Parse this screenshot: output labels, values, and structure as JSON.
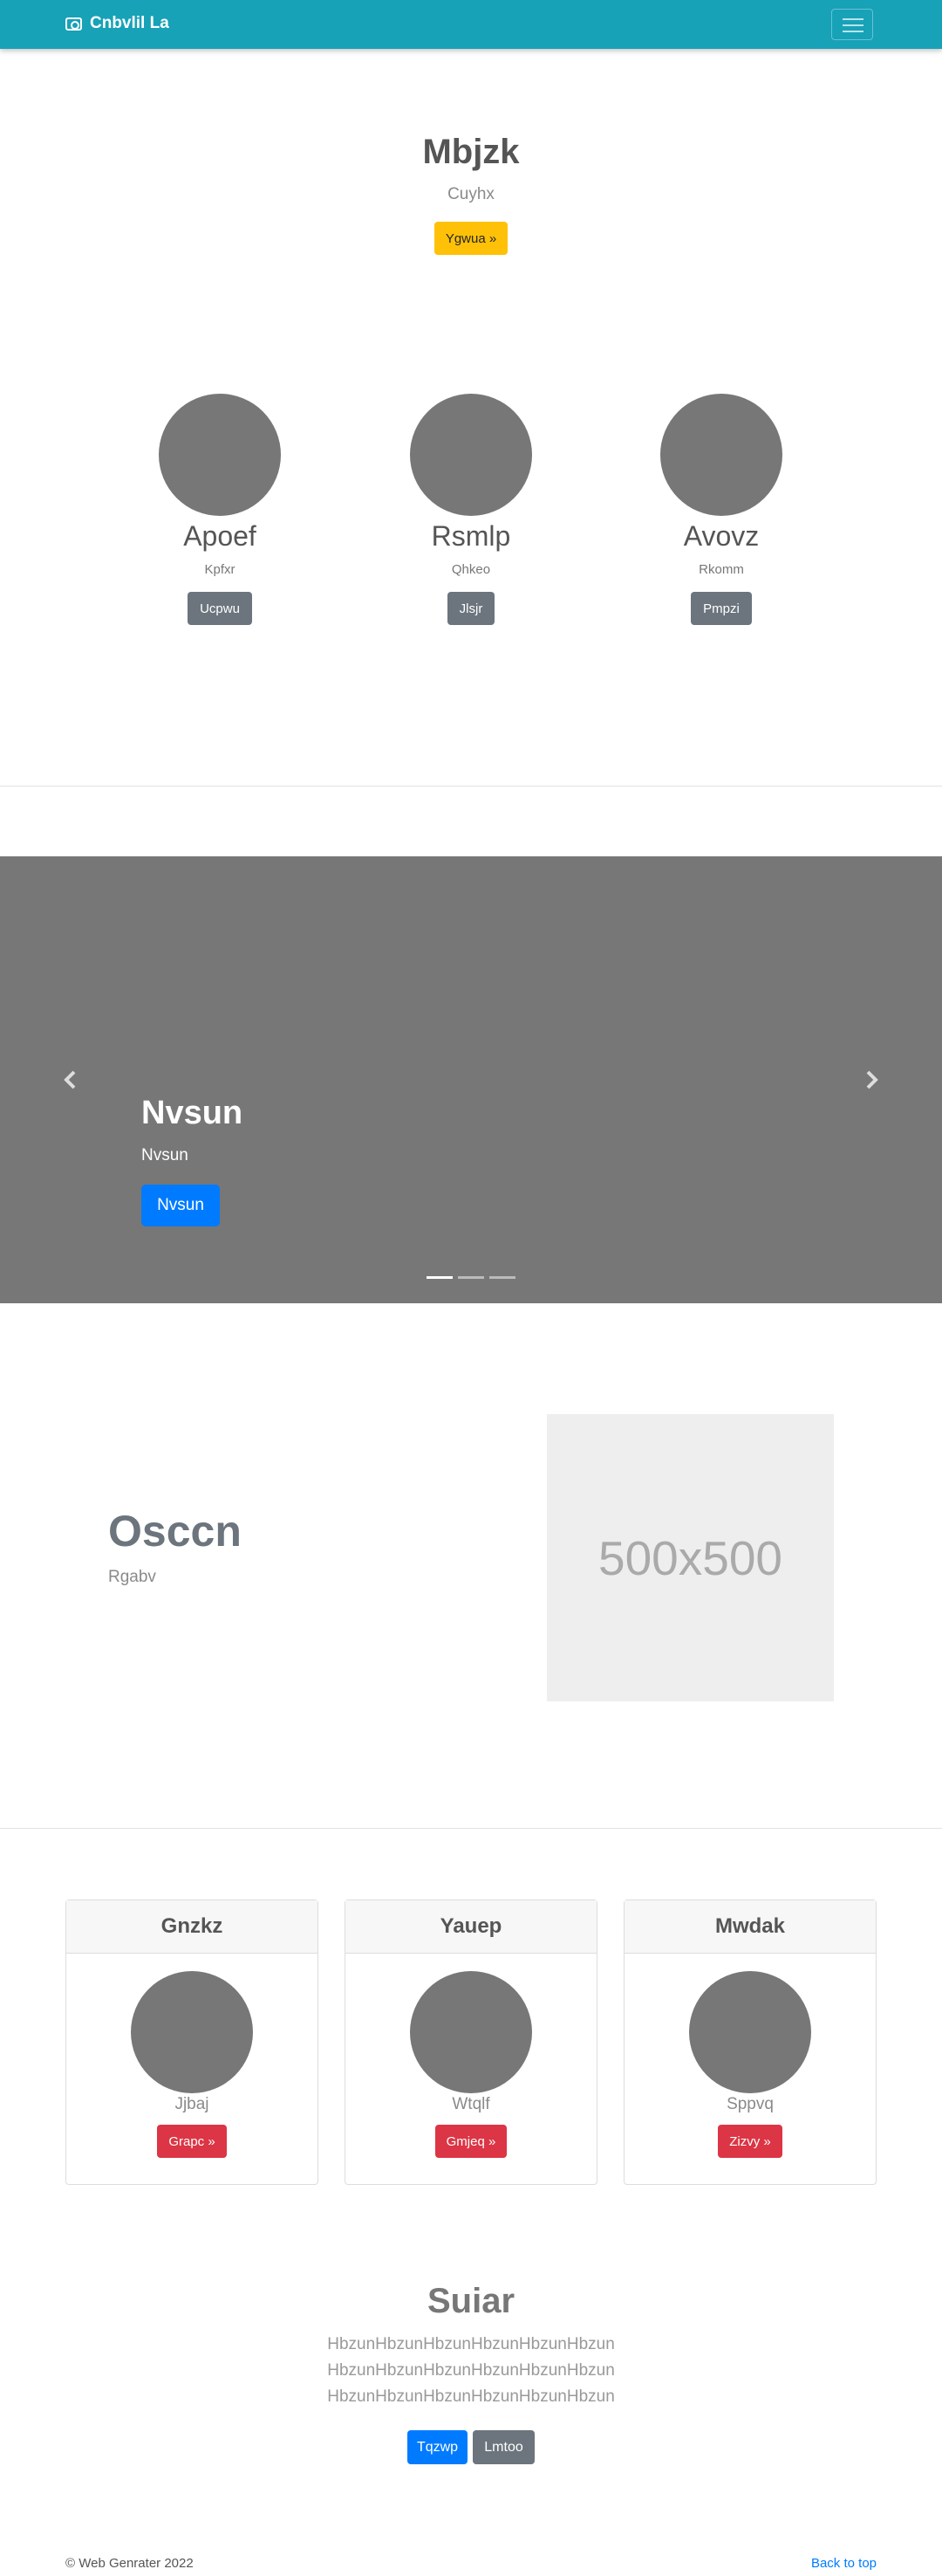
{
  "navbar": {
    "brand": "Cnbvlil La",
    "brand_icon": "camera-icon",
    "toggle_icon": "hamburger-icon",
    "bg_color": "#17a2b8"
  },
  "hero": {
    "title": "Mbjzk",
    "subtitle": "Cuyhx",
    "button": "Ygwua »"
  },
  "team": [
    {
      "name": "Apoef",
      "role": "Kpfxr",
      "button": "Ucpwu"
    },
    {
      "name": "Rsmlp",
      "role": "Qhkeo",
      "button": "Jlsjr"
    },
    {
      "name": "Avovz",
      "role": "Rkomm",
      "button": "Pmpzi"
    }
  ],
  "carousel": {
    "title": "Nvsun",
    "subtitle": "Nvsun",
    "button": "Nvsun",
    "prev_icon": "chevron-left-icon",
    "next_icon": "chevron-right-icon",
    "slides": 3,
    "active_slide": 1
  },
  "feature": {
    "title": "Osccn",
    "subtitle": "Rgabv",
    "image_label": "500x500"
  },
  "cards": [
    {
      "title": "Gnzkz",
      "subtitle": "Jjbaj",
      "button": "Grapc »"
    },
    {
      "title": "Yauep",
      "subtitle": "Wtqlf",
      "button": "Gmjeq »"
    },
    {
      "title": "Mwdak",
      "subtitle": "Sppvq",
      "button": "Zizvy »"
    }
  ],
  "cta": {
    "title": "Suiar",
    "lines": [
      "HbzunHbzunHbzunHbzunHbzunHbzun",
      "HbzunHbzunHbzunHbzunHbzunHbzun",
      "HbzunHbzunHbzunHbzunHbzunHbzun"
    ],
    "primary_button": "Tqzwp",
    "secondary_button": "Lmtoo"
  },
  "footer": {
    "copyright": "© Web Genrater 2022",
    "back_to_top": "Back to top"
  }
}
